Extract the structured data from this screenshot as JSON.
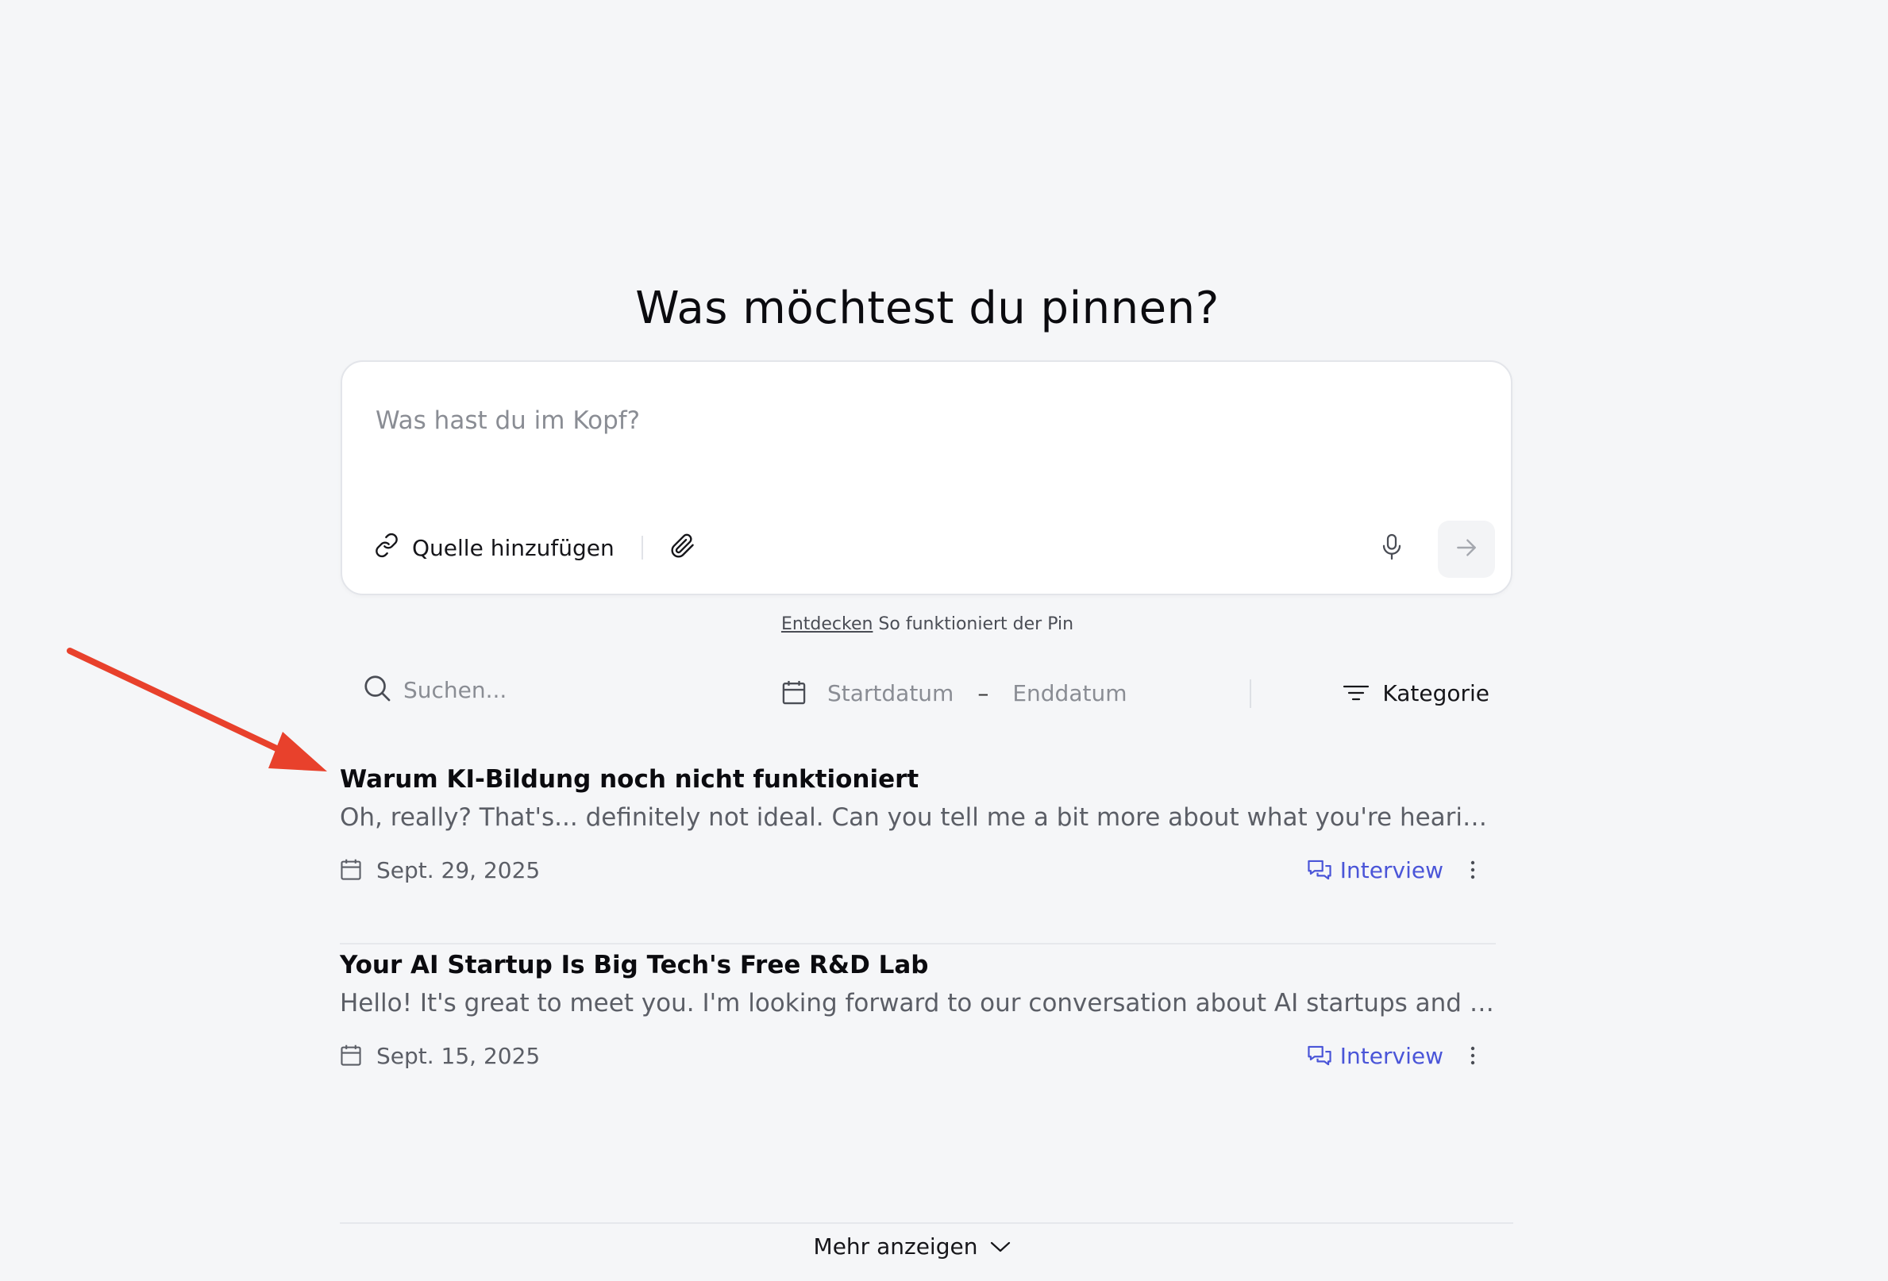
{
  "page": {
    "title": "Was möchtest du pinnen?"
  },
  "composer": {
    "placeholder": "Was hast du im Kopf?",
    "source_label": "Quelle hinzufügen",
    "icons": {
      "source": "link-icon",
      "attach": "paperclip-icon",
      "mic": "microphone-icon",
      "send": "arrow-right-icon"
    }
  },
  "hint": {
    "link_text": "Entdecken",
    "text": " So funktioniert der Pin"
  },
  "filters": {
    "search_placeholder": "Suchen...",
    "start_date": "Startdatum",
    "separator": "–",
    "end_date": "Enddatum",
    "category_label": "Kategorie"
  },
  "items": [
    {
      "title": "Warum KI-Bildung noch nicht funktioniert",
      "excerpt": "Oh, really? That's... definitely not ideal. Can you tell me a bit more about what you're hearing or experiencing?",
      "date": "Sept. 29, 2025",
      "type": "Interview"
    },
    {
      "title": "Your AI Startup Is Big Tech's Free R&D Lab",
      "excerpt": "Hello! It's great to meet you. I'm looking forward to our conversation about AI startups and their relationship with big tech.",
      "date": "Sept. 15, 2025",
      "type": "Interview"
    }
  ],
  "footer": {
    "more_label": "Mehr anzeigen"
  },
  "colors": {
    "background": "#f5f6f8",
    "accent": "#4a55d8",
    "annotation_arrow": "#e8412c"
  }
}
